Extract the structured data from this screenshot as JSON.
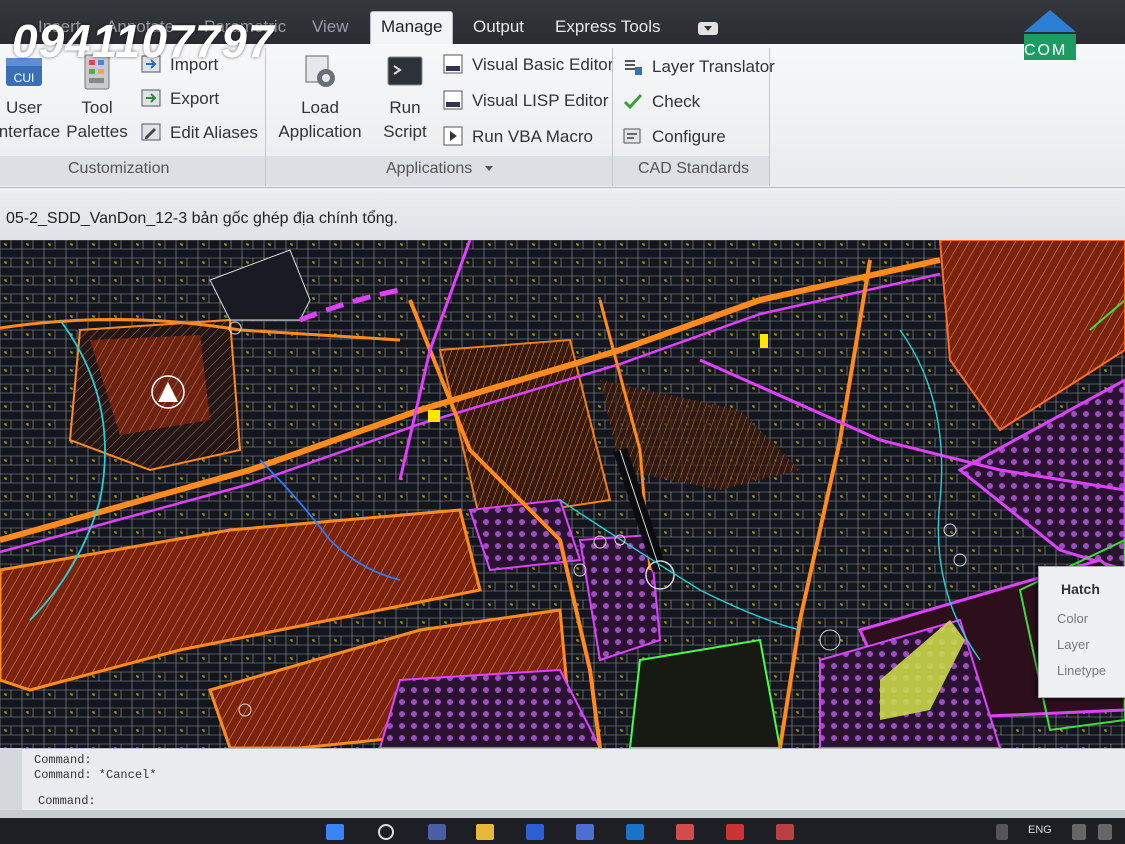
{
  "ribbon": {
    "tabs": [
      {
        "label": "Insert",
        "state": "dim"
      },
      {
        "label": "Annotate",
        "state": "dim"
      },
      {
        "label": "Parametric",
        "state": "dim"
      },
      {
        "label": "View",
        "state": "dim"
      },
      {
        "label": "Manage",
        "state": "active"
      },
      {
        "label": "Output",
        "state": "normal"
      },
      {
        "label": "Express Tools",
        "state": "normal"
      }
    ],
    "customization": {
      "title": "Customization",
      "user_interface": {
        "icon_text": "CUI",
        "label_1": "User",
        "label_2": "Interface"
      },
      "tool_palettes": {
        "label_1": "Tool",
        "label_2": "Palettes"
      },
      "import": "Import",
      "export": "Export",
      "edit_aliases": "Edit Aliases"
    },
    "applications": {
      "title": "Applications",
      "load_application": {
        "label_1": "Load",
        "label_2": "Application"
      },
      "run_script": {
        "label_1": "Run",
        "label_2": "Script"
      },
      "visual_basic_editor": "Visual Basic Editor",
      "visual_lisp_editor": "Visual LISP Editor",
      "run_vba_macro": "Run VBA Macro"
    },
    "cad_standards": {
      "title": "CAD Standards",
      "layer_translator": "Layer Translator",
      "check": "Check",
      "configure": "Configure"
    }
  },
  "document": {
    "title": "05-2_SDD_VanDon_12-3 bản gốc ghép địa chính tổng."
  },
  "hatch_popup": {
    "title": "Hatch",
    "rows": [
      "Color",
      "Layer",
      "Linetype"
    ]
  },
  "command_line": {
    "history": [
      "Command:",
      "Command: *Cancel*"
    ],
    "prompt": "Command:"
  },
  "taskbar": {
    "language": "ENG"
  },
  "overlays": {
    "phone_watermark": "0941107797",
    "logo_text": "COM"
  },
  "colors": {
    "ribbon_bg": "#eef0f2",
    "tabbar_bg": "#2f3136",
    "canvas_bg": "#11131a",
    "parcel_lines": "#e8e8e8",
    "road_orange": "#ff8a1e",
    "boundary_magenta": "#e040ff",
    "hatch_brown": "#8a2a12",
    "marker_yellow": "#ffe600",
    "contour_cyan": "#27d0d6"
  }
}
